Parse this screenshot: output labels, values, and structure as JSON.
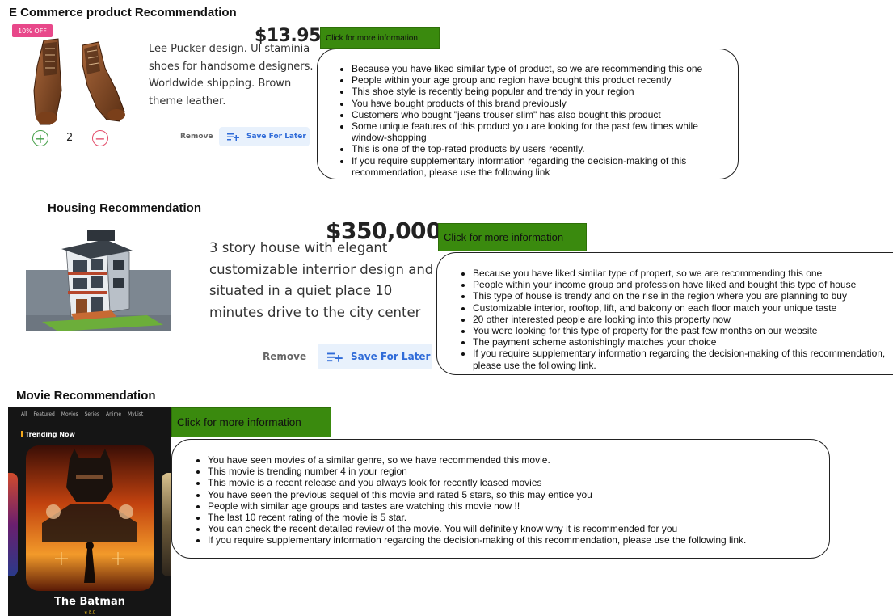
{
  "ecommerce": {
    "title": "E Commerce product Recommendation",
    "badge": "10% OFF",
    "price": "$13.95",
    "description_lines": [
      "Lee Pucker design. Ul staminia",
      "shoes for handsome designers.",
      "Worldwide shipping. Brown",
      "theme leather."
    ],
    "quantity": "2",
    "remove_label": "Remove",
    "save_label": "Save For Later",
    "info_button": "Click for more information",
    "reasons": [
      "Because you have liked similar type of product, so we are recommending this one",
      "People within your age group and region have bought this product recently",
      "This shoe style is recently being popular and trendy in your region",
      "You have bought products of this brand previously",
      "Customers who bought \"jeans trouser slim\" has also bought this product",
      "Some unique features of this product you are looking for the past few times while window-shopping",
      "This is one of the top-rated products by users recently.",
      "If you require supplementary information regarding the decision-making of this recommendation, please use the following link"
    ]
  },
  "housing": {
    "title": "Housing Recommendation",
    "price": "$350,000",
    "description_lines": [
      "3 story house with elegant",
      "customizable interrior design and",
      "situated in a quiet place 10",
      "minutes drive to the city center"
    ],
    "remove_label": "Remove",
    "save_label": "Save For Later",
    "info_button": "Click for more information",
    "reasons": [
      "Because you have liked similar type of propert, so we are recommending this one",
      "People within your income group and profession have liked and bought this type of house",
      "This type of house is trendy and on the rise in the region where you are planning to buy",
      "Customizable interior, rooftop, lift, and balcony on each floor match your unique taste",
      "20 other interested people are looking into this property now",
      "You were looking for this type of property for the past few months on our website",
      "The payment scheme astonishingly matches your choice",
      "If you require supplementary information regarding the decision-making of this recommendation, please use the following link."
    ]
  },
  "movie": {
    "title": "Movie Recommendation",
    "nav": [
      "All",
      "Featured",
      "Movies",
      "Series",
      "Anime",
      "MyList"
    ],
    "trending": "Trending Now",
    "poster_title": "The Batman",
    "poster_rating": "★ 8.0",
    "info_button": "Click for more information",
    "reasons": [
      "You have seen movies of a similar genre, so we have recommended this movie.",
      "This movie is trending number 4 in your region",
      "This movie is a recent release and you always look for recently leased movies",
      "You have seen the previous sequel of this movie and rated 5 stars, so this may entice you",
      "People with similar age groups and tastes are watching this movie now !!",
      "The last 10 recent rating of the movie is 5 star.",
      "You can check the recent detailed review of the movie. You will definitely know why it is recommended for you",
      "If you require supplementary information regarding the decision-making of this recommendation, please use the following link."
    ]
  }
}
